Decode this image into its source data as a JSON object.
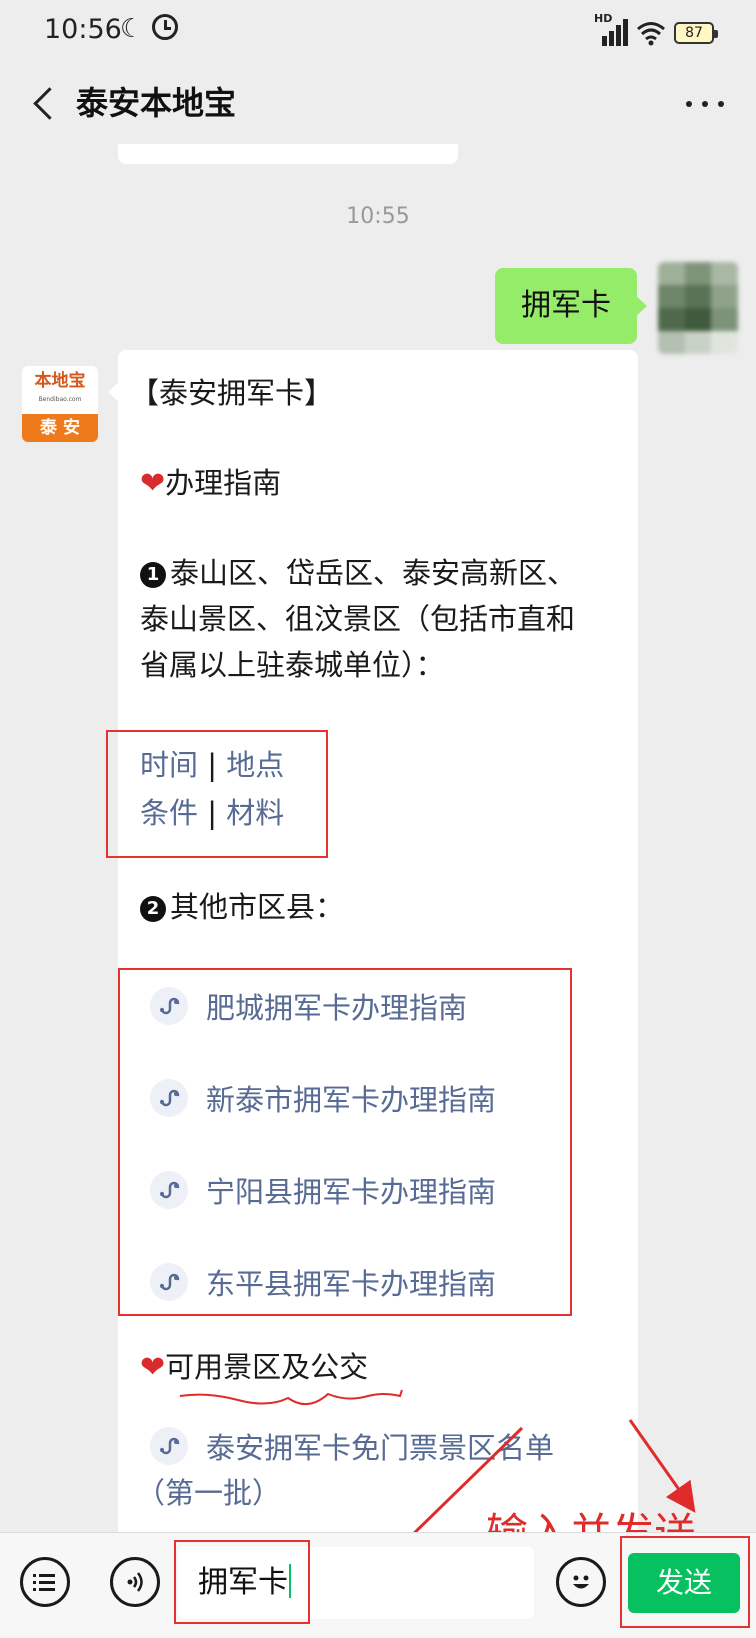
{
  "status_bar": {
    "time": "10:56",
    "network_label": "HD",
    "battery": "87"
  },
  "header": {
    "title": "泰安本地宝"
  },
  "chat": {
    "timestamp": "10:55",
    "outgoing_message": "拥军卡",
    "bot_avatar": {
      "brand": "本地宝",
      "site": "Bendibao.com",
      "city": "泰 安"
    },
    "reply": {
      "title": "【泰安拥军卡】",
      "section1_heading": "办理指南",
      "item1_lines": [
        "泰山区、岱岳区、泰安高新区、",
        "泰山景区、徂汶景区（包括市直和",
        "省属以上驻泰城单位）："
      ],
      "item1_links": {
        "time": "时间",
        "place": "地点",
        "conditions": "条件",
        "materials": "材料"
      },
      "item2_heading": "其他市区县：",
      "mini_program_links": [
        "肥城拥军卡办理指南",
        "新泰市拥军卡办理指南",
        "宁阳县拥军卡办理指南",
        "东平县拥军卡办理指南"
      ],
      "section2_heading": "可用景区及公交",
      "scenic_link_line1": "泰安拥军卡免门票景区名单",
      "scenic_link_line2": "（第一批）"
    }
  },
  "annotation": {
    "text": "输入并发送",
    "color": "#e02b2b"
  },
  "input_bar": {
    "input_value": "拥军卡",
    "send_label": "发送"
  },
  "colors": {
    "outgoing_bubble": "#95ec69",
    "link": "#576b95",
    "send_button": "#07c160",
    "highlight_box": "#e53333"
  }
}
